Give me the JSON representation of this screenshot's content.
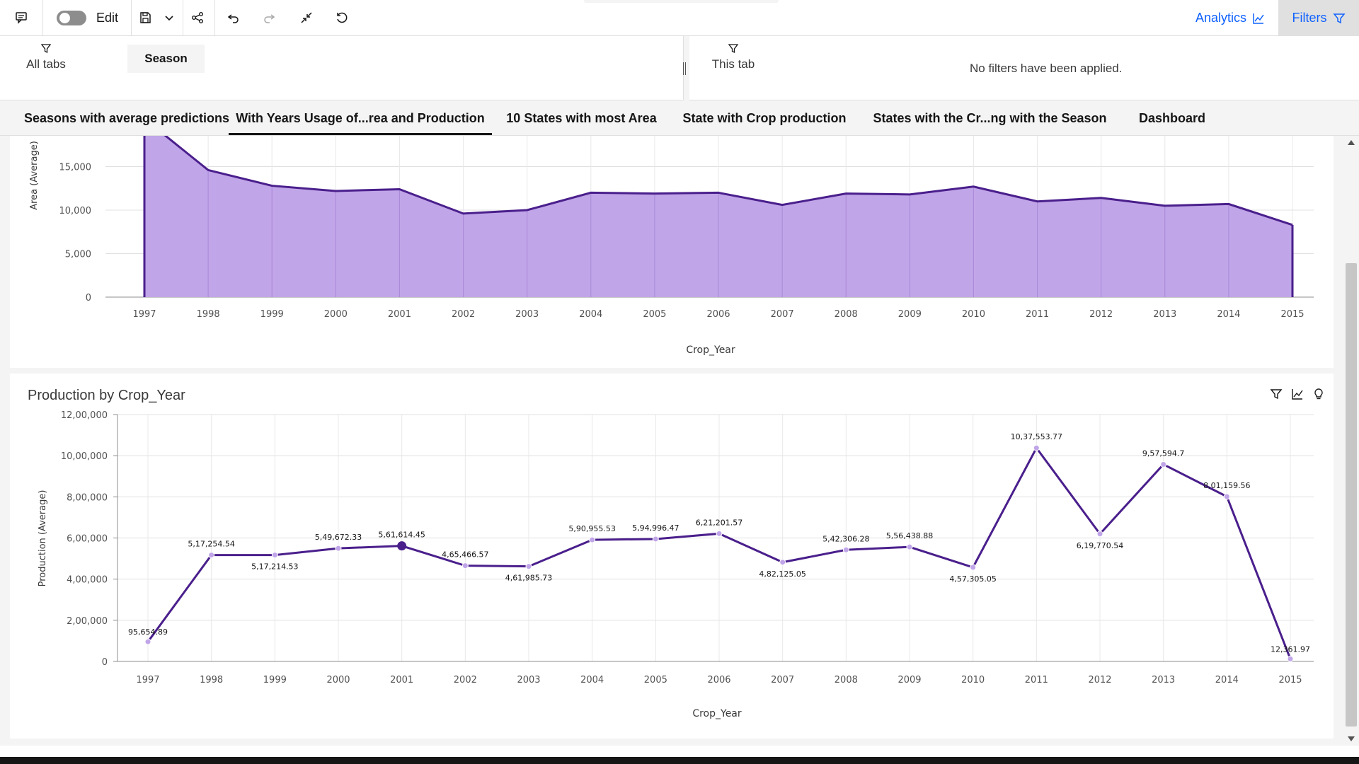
{
  "toolbar": {
    "edit_label": "Edit",
    "analytics_label": "Analytics",
    "filters_label": "Filters",
    "edit_toggle_on": false
  },
  "filters": {
    "all_tabs_label": "All tabs",
    "season_chip": "Season",
    "this_tab_label": "This tab",
    "no_filters_text": "No filters have been applied."
  },
  "tabs": [
    {
      "label": "Seasons with average predictions",
      "active": false
    },
    {
      "label": "With Years Usage of...rea and Production",
      "active": true
    },
    {
      "label": "10 States with most Area",
      "active": false
    },
    {
      "label": "State with Crop production",
      "active": false
    },
    {
      "label": "States with  the Cr...ng with the Season",
      "active": false
    },
    {
      "label": "Dashboard",
      "active": false
    }
  ],
  "colors": {
    "accent": "#0f62fe",
    "series_line": "#4a1f8c",
    "area_fill": "#c0a5e8"
  },
  "chart_data": [
    {
      "type": "area",
      "title": "",
      "xlabel": "Crop_Year",
      "ylabel": "Area (Average)",
      "x": [
        "1997",
        "1998",
        "1999",
        "2000",
        "2001",
        "2002",
        "2003",
        "2004",
        "2005",
        "2006",
        "2007",
        "2008",
        "2009",
        "2010",
        "2011",
        "2012",
        "2013",
        "2014",
        "2015"
      ],
      "y_ticks": [
        "0",
        "5,000",
        "10,000",
        "15,000"
      ],
      "ylim": [
        0,
        15000
      ],
      "series": [
        {
          "values": [
            20500,
            14600,
            12800,
            12200,
            12400,
            9600,
            10000,
            12000,
            11900,
            12000,
            10600,
            11900,
            11800,
            12700,
            11000,
            11400,
            10500,
            10700,
            8300
          ]
        }
      ],
      "grid": true
    },
    {
      "type": "line",
      "title": "Production by Crop_Year",
      "xlabel": "Crop_Year",
      "ylabel": "Production (Average)",
      "x": [
        "1997",
        "1998",
        "1999",
        "2000",
        "2001",
        "2002",
        "2003",
        "2004",
        "2005",
        "2006",
        "2007",
        "2008",
        "2009",
        "2010",
        "2011",
        "2012",
        "2013",
        "2014",
        "2015"
      ],
      "y_ticks": [
        "0",
        "2,00,000",
        "4,00,000",
        "6,00,000",
        "8,00,000",
        "10,00,000",
        "12,00,000"
      ],
      "ylim": [
        0,
        1200000
      ],
      "series": [
        {
          "values": [
            95654.89,
            517254.54,
            517214.53,
            549672.33,
            561614.45,
            465466.57,
            461985.73,
            590955.53,
            594996.47,
            621201.57,
            482125.05,
            542306.28,
            556438.88,
            457305.05,
            1037553.77,
            619770.54,
            957594.7,
            801159.56,
            12361.97
          ],
          "labels": [
            "95,654.89",
            "5,17,254.54",
            "5,17,214.53",
            "5,49,672.33",
            "5,61,614.45",
            "4,65,466.57",
            "4,61,985.73",
            "5,90,955.53",
            "5,94,996.47",
            "6,21,201.57",
            "4,82,125.05",
            "5,42,306.28",
            "5,56,438.88",
            "4,57,305.05",
            "10,37,553.77",
            "6,19,770.54",
            "9,57,594.7",
            "8,01,159.56",
            "12,361.97"
          ]
        }
      ],
      "highlighted_index": 4,
      "grid": true
    }
  ]
}
